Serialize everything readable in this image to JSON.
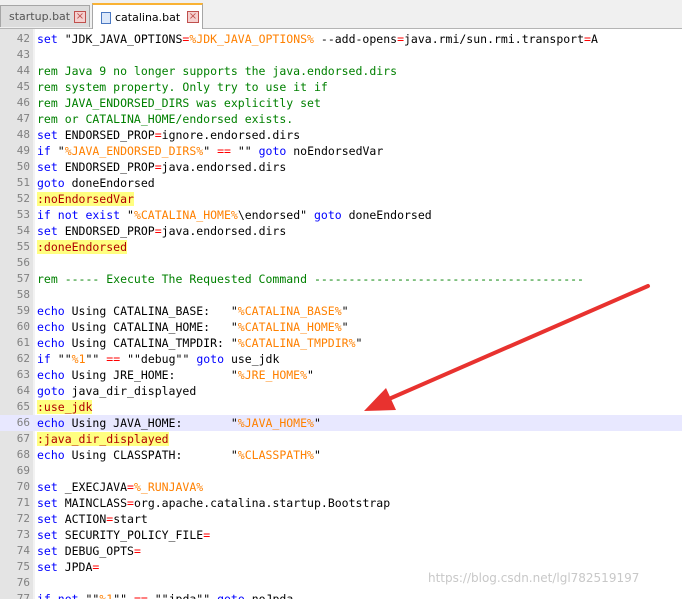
{
  "tabs": [
    {
      "label": "startup.bat",
      "active": false
    },
    {
      "label": "catalina.bat",
      "active": true
    }
  ],
  "current_line": 66,
  "lines": [
    {
      "n": "42",
      "tokens": [
        {
          "t": "set",
          "c": "kw"
        },
        {
          "t": " \"JDK_JAVA_OPTIONS"
        },
        {
          "t": "=",
          "c": "op"
        },
        {
          "t": "%JDK_JAVA_OPTIONS%",
          "c": "var"
        },
        {
          "t": " --add-opens"
        },
        {
          "t": "=",
          "c": "op"
        },
        {
          "t": "java.rmi/sun.rmi.transport"
        },
        {
          "t": "=",
          "c": "op"
        },
        {
          "t": "A"
        }
      ]
    },
    {
      "n": "43",
      "tokens": []
    },
    {
      "n": "44",
      "tokens": [
        {
          "t": "rem Java 9 no longer supports the java.endorsed.dirs",
          "c": "cm"
        }
      ]
    },
    {
      "n": "45",
      "tokens": [
        {
          "t": "rem system property. Only try to use it if",
          "c": "cm"
        }
      ]
    },
    {
      "n": "46",
      "tokens": [
        {
          "t": "rem JAVA_ENDORSED_DIRS was explicitly set",
          "c": "cm"
        }
      ]
    },
    {
      "n": "47",
      "tokens": [
        {
          "t": "rem or CATALINA_HOME/endorsed exists.",
          "c": "cm"
        }
      ]
    },
    {
      "n": "48",
      "tokens": [
        {
          "t": "set",
          "c": "kw"
        },
        {
          "t": " ENDORSED_PROP"
        },
        {
          "t": "=",
          "c": "op"
        },
        {
          "t": "ignore.endorsed.dirs"
        }
      ]
    },
    {
      "n": "49",
      "tokens": [
        {
          "t": "if",
          "c": "kw"
        },
        {
          "t": " \""
        },
        {
          "t": "%JAVA_ENDORSED_DIRS%",
          "c": "var"
        },
        {
          "t": "\" "
        },
        {
          "t": "==",
          "c": "op"
        },
        {
          "t": " \"\" "
        },
        {
          "t": "goto",
          "c": "kw"
        },
        {
          "t": " noEndorsedVar"
        }
      ]
    },
    {
      "n": "50",
      "tokens": [
        {
          "t": "set",
          "c": "kw"
        },
        {
          "t": " ENDORSED_PROP"
        },
        {
          "t": "=",
          "c": "op"
        },
        {
          "t": "java.endorsed.dirs"
        }
      ]
    },
    {
      "n": "51",
      "tokens": [
        {
          "t": "goto",
          "c": "kw"
        },
        {
          "t": " doneEndorsed"
        }
      ]
    },
    {
      "n": "52",
      "tokens": [
        {
          "t": ":noEndorsedVar",
          "c": "lbl"
        }
      ]
    },
    {
      "n": "53",
      "tokens": [
        {
          "t": "if not exist",
          "c": "kw"
        },
        {
          "t": " \""
        },
        {
          "t": "%CATALINA_HOME%",
          "c": "var"
        },
        {
          "t": "\\endorsed\" "
        },
        {
          "t": "goto",
          "c": "kw"
        },
        {
          "t": " doneEndorsed"
        }
      ]
    },
    {
      "n": "54",
      "tokens": [
        {
          "t": "set",
          "c": "kw"
        },
        {
          "t": " ENDORSED_PROP"
        },
        {
          "t": "=",
          "c": "op"
        },
        {
          "t": "java.endorsed.dirs"
        }
      ]
    },
    {
      "n": "55",
      "tokens": [
        {
          "t": ":doneEndorsed",
          "c": "lbl"
        }
      ]
    },
    {
      "n": "56",
      "tokens": []
    },
    {
      "n": "57",
      "tokens": [
        {
          "t": "rem ----- Execute The Requested Command ---------------------------------------",
          "c": "cm"
        }
      ]
    },
    {
      "n": "58",
      "tokens": []
    },
    {
      "n": "59",
      "tokens": [
        {
          "t": "echo",
          "c": "kw"
        },
        {
          "t": " Using CATALINA_BASE:   \""
        },
        {
          "t": "%CATALINA_BASE%",
          "c": "var"
        },
        {
          "t": "\""
        }
      ]
    },
    {
      "n": "60",
      "tokens": [
        {
          "t": "echo",
          "c": "kw"
        },
        {
          "t": " Using CATALINA_HOME:   \""
        },
        {
          "t": "%CATALINA_HOME%",
          "c": "var"
        },
        {
          "t": "\""
        }
      ]
    },
    {
      "n": "61",
      "tokens": [
        {
          "t": "echo",
          "c": "kw"
        },
        {
          "t": " Using CATALINA_TMPDIR: \""
        },
        {
          "t": "%CATALINA_TMPDIR%",
          "c": "var"
        },
        {
          "t": "\""
        }
      ]
    },
    {
      "n": "62",
      "tokens": [
        {
          "t": "if",
          "c": "kw"
        },
        {
          "t": " \"\""
        },
        {
          "t": "%1",
          "c": "var"
        },
        {
          "t": "\"\" "
        },
        {
          "t": "==",
          "c": "op"
        },
        {
          "t": " \"\"debug\"\" "
        },
        {
          "t": "goto",
          "c": "kw"
        },
        {
          "t": " use_jdk"
        }
      ]
    },
    {
      "n": "63",
      "tokens": [
        {
          "t": "echo",
          "c": "kw"
        },
        {
          "t": " Using JRE_HOME:        \""
        },
        {
          "t": "%JRE_HOME%",
          "c": "var"
        },
        {
          "t": "\""
        }
      ]
    },
    {
      "n": "64",
      "tokens": [
        {
          "t": "goto",
          "c": "kw"
        },
        {
          "t": " java_dir_displayed"
        }
      ]
    },
    {
      "n": "65",
      "tokens": [
        {
          "t": ":use_jdk",
          "c": "lbl"
        }
      ]
    },
    {
      "n": "66",
      "tokens": [
        {
          "t": "echo",
          "c": "kw"
        },
        {
          "t": " Using JAVA_HOME:       \""
        },
        {
          "t": "%JAVA_HOME%",
          "c": "var"
        },
        {
          "t": "\""
        }
      ]
    },
    {
      "n": "67",
      "tokens": [
        {
          "t": ":java_dir_displayed",
          "c": "lbl"
        }
      ]
    },
    {
      "n": "68",
      "tokens": [
        {
          "t": "echo",
          "c": "kw"
        },
        {
          "t": " Using CLASSPATH:       \""
        },
        {
          "t": "%CLASSPATH%",
          "c": "var"
        },
        {
          "t": "\""
        }
      ]
    },
    {
      "n": "69",
      "tokens": []
    },
    {
      "n": "70",
      "tokens": [
        {
          "t": "set",
          "c": "kw"
        },
        {
          "t": " _EXECJAVA"
        },
        {
          "t": "=",
          "c": "op"
        },
        {
          "t": "%_RUNJAVA%",
          "c": "var"
        }
      ]
    },
    {
      "n": "71",
      "tokens": [
        {
          "t": "set",
          "c": "kw"
        },
        {
          "t": " MAINCLASS"
        },
        {
          "t": "=",
          "c": "op"
        },
        {
          "t": "org.apache.catalina.startup.Bootstrap"
        }
      ]
    },
    {
      "n": "72",
      "tokens": [
        {
          "t": "set",
          "c": "kw"
        },
        {
          "t": " ACTION"
        },
        {
          "t": "=",
          "c": "op"
        },
        {
          "t": "start"
        }
      ]
    },
    {
      "n": "73",
      "tokens": [
        {
          "t": "set",
          "c": "kw"
        },
        {
          "t": " SECURITY_POLICY_FILE"
        },
        {
          "t": "=",
          "c": "op"
        }
      ]
    },
    {
      "n": "74",
      "tokens": [
        {
          "t": "set",
          "c": "kw"
        },
        {
          "t": " DEBUG_OPTS"
        },
        {
          "t": "=",
          "c": "op"
        }
      ]
    },
    {
      "n": "75",
      "tokens": [
        {
          "t": "set",
          "c": "kw"
        },
        {
          "t": " JPDA"
        },
        {
          "t": "=",
          "c": "op"
        }
      ]
    },
    {
      "n": "76",
      "tokens": []
    },
    {
      "n": "77",
      "tokens": [
        {
          "t": "if not",
          "c": "kw"
        },
        {
          "t": " \"\""
        },
        {
          "t": "%1",
          "c": "var"
        },
        {
          "t": "\"\" "
        },
        {
          "t": "==",
          "c": "op"
        },
        {
          "t": " \"\"jpda\"\" "
        },
        {
          "t": "goto",
          "c": "kw"
        },
        {
          "t": " noJpda"
        }
      ]
    }
  ],
  "watermark": "https://blog.csdn.net/lgl782519197",
  "annotation": {
    "type": "red-arrow",
    "points_to_line": 66,
    "color": "#e8322f"
  },
  "colors": {
    "keyword": "#0000ff",
    "comment": "#008000",
    "variable": "#ff8000",
    "operator": "#ff0000",
    "label_bg": "#ffff80",
    "label_fg": "#b00000",
    "current_line_bg": "#e8e8ff"
  }
}
